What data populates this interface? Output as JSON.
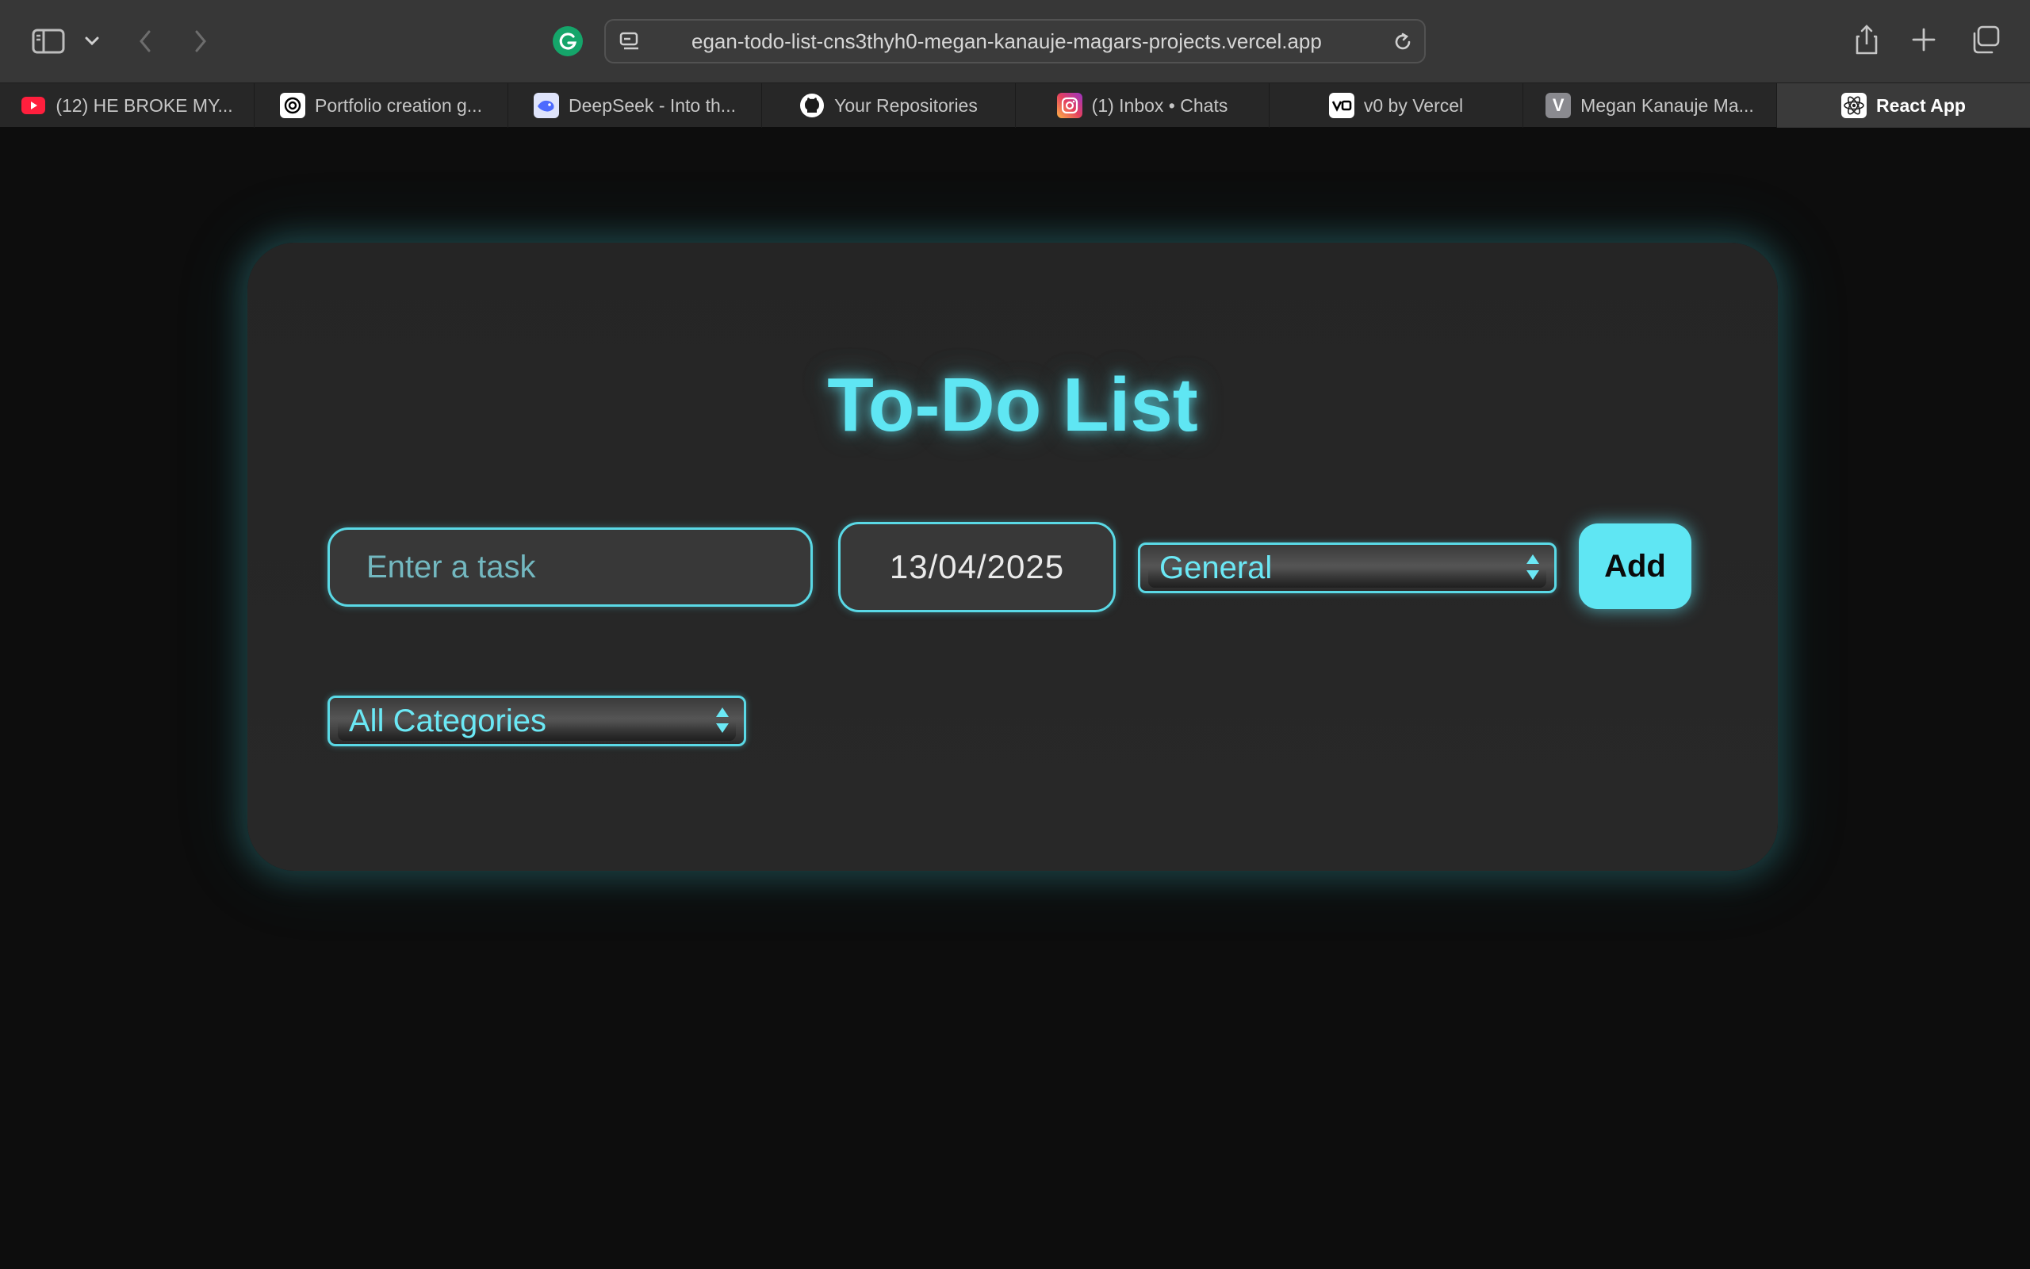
{
  "browser": {
    "url": "egan-todo-list-cns3thyh0-megan-kanauje-magars-projects.vercel.app",
    "tabs": [
      {
        "label": "(12) HE BROKE MY...",
        "icon": "youtube-icon",
        "active": false
      },
      {
        "label": "Portfolio creation g...",
        "icon": "openai-icon",
        "active": false
      },
      {
        "label": "DeepSeek - Into th...",
        "icon": "deepseek-icon",
        "active": false
      },
      {
        "label": "Your Repositories",
        "icon": "github-icon",
        "active": false
      },
      {
        "label": "(1) Inbox • Chats",
        "icon": "instagram-icon",
        "active": false
      },
      {
        "label": "v0 by Vercel",
        "icon": "v0-icon",
        "active": false
      },
      {
        "label": "Megan Kanauje Ma...",
        "icon": "vercel-v-icon",
        "active": false
      },
      {
        "label": "React App",
        "icon": "react-icon",
        "active": true
      }
    ]
  },
  "app": {
    "title": "To-Do List",
    "task_placeholder": "Enter a task",
    "date_value": "13/04/2025",
    "category_selected": "General",
    "add_label": "Add",
    "filter_selected": "All Categories"
  },
  "colors": {
    "accent": "#5fe6f3",
    "background": "#0d0d0d",
    "card": "#262626",
    "chrome": "#373737"
  }
}
